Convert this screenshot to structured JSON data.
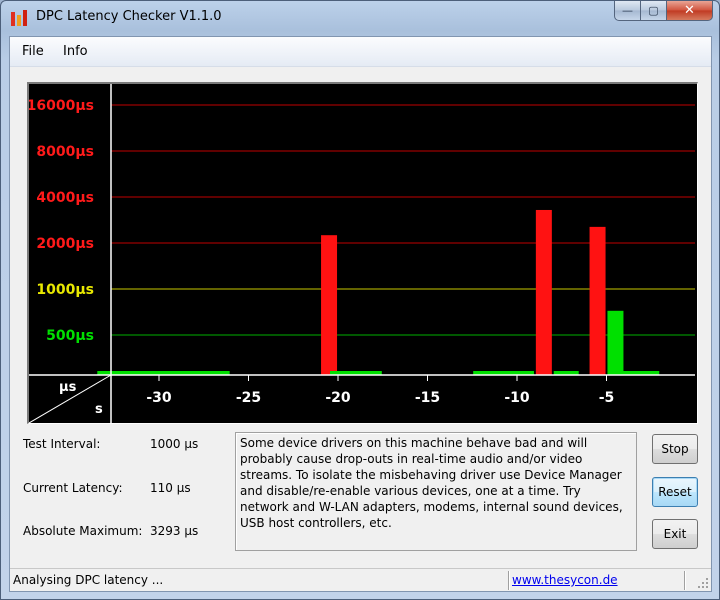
{
  "window": {
    "title": "DPC Latency Checker V1.1.0",
    "minimize_glyph": "—",
    "maximize_glyph": "▢",
    "close_glyph": "✕"
  },
  "menu": {
    "file": "File",
    "info": "Info"
  },
  "chart_data": {
    "type": "bar",
    "title": "",
    "xlabel": "s",
    "ylabel": "µs",
    "x_ticks": [
      -30,
      -25,
      -20,
      -15,
      -10,
      -5
    ],
    "x_tick_labels": [
      "-30",
      "-25",
      "-20",
      "-15",
      "-10",
      "-5"
    ],
    "y_ticks": [
      {
        "value": 500,
        "label": "500µs",
        "color": "#00e000"
      },
      {
        "value": 1000,
        "label": "1000µs",
        "color": "#e8e800"
      },
      {
        "value": 2000,
        "label": "2000µs",
        "color": "#ff1a1a"
      },
      {
        "value": 4000,
        "label": "4000µs",
        "color": "#ff1a1a"
      },
      {
        "value": 8000,
        "label": "8000µs",
        "color": "#ff1a1a"
      },
      {
        "value": 16000,
        "label": "16000µs",
        "color": "#ff1a1a"
      }
    ],
    "scale": "log2",
    "interval_s": 0.5,
    "values": [
      150,
      230,
      235,
      130,
      240,
      140,
      130,
      140,
      140,
      140,
      140,
      130,
      140,
      130,
      2250,
      260,
      120,
      130,
      140,
      130,
      130,
      140,
      140,
      140,
      140,
      130,
      3290,
      120,
      130,
      2550,
      720,
      250,
      200,
      280,
      250
    ],
    "x": [
      -33,
      -32.5,
      -32,
      -31.5,
      -31,
      -30.5,
      -30,
      -29.5,
      -29,
      -28.5,
      -28,
      -27.5,
      -27,
      -26.5,
      -20.5,
      -20,
      -19.5,
      -19,
      -18.5,
      -18,
      -12,
      -11.5,
      -11,
      -10.5,
      -10,
      -9.5,
      -8.5,
      -7.5,
      -7,
      -5.5,
      -4.5,
      -4,
      -3.5,
      -3,
      -2.5
    ],
    "colors": {
      "green": "#00e000",
      "red": "#ff1212",
      "yellow": "#e8e800"
    }
  },
  "info": {
    "test_interval_label": "Test Interval:",
    "test_interval_value": "1000 µs",
    "current_latency_label": "Current Latency:",
    "current_latency_value": "110 µs",
    "absolute_maximum_label": "Absolute Maximum:",
    "absolute_maximum_value": "3293 µs"
  },
  "message": "Some device drivers on this machine behave bad and will probably cause drop-outs in real-time audio and/or video streams. To isolate the misbehaving driver use Device Manager and disable/re-enable various devices, one at a time. Try network and W-LAN adapters, modems, internal sound devices, USB host controllers, etc.",
  "buttons": {
    "stop": "Stop",
    "reset": "Reset",
    "exit": "Exit"
  },
  "status": {
    "text": "Analysing DPC latency ...",
    "link": "www.thesycon.de"
  }
}
